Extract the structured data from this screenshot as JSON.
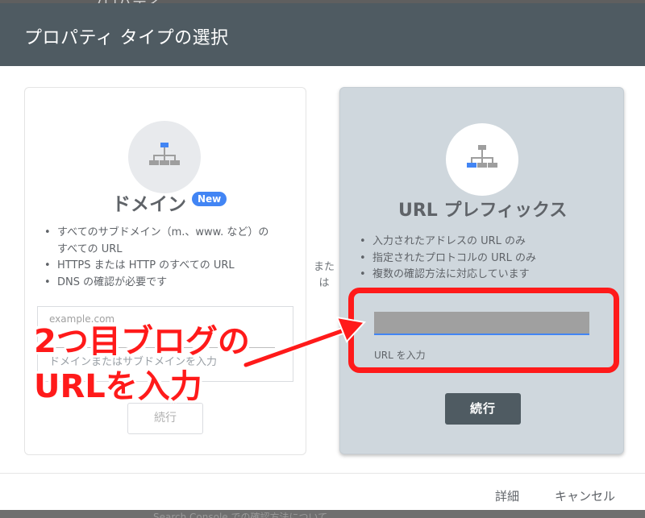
{
  "background": {
    "partial_title": "プロパティ",
    "partial_footer": "Search Console での確認方法について"
  },
  "dialog": {
    "title": "プロパティ タイプの選択"
  },
  "domain_card": {
    "title": "ドメイン",
    "badge": "New",
    "features": [
      "すべてのサブドメイン（m.、www. など）の\nすべての URL",
      "HTTPS または HTTP のすべての URL",
      "DNS の確認が必要です"
    ],
    "input_value": "example.com",
    "input_label": "ドメインまたはサブドメインを入力",
    "continue_label": "続行"
  },
  "separator": {
    "text": "または"
  },
  "url_prefix_card": {
    "title": "URL プレフィックス",
    "features": [
      "入力されたアドレスの URL のみ",
      "指定されたプロトコルの URL のみ",
      "複数の確認方法に対応しています"
    ],
    "input_value": "",
    "input_label": "URL を入力",
    "continue_label": "続行"
  },
  "footer": {
    "details_label": "詳細",
    "cancel_label": "キャンセル"
  },
  "annotation": {
    "line1": "2つ目ブログの",
    "line2": "URLを入力",
    "color": "#ff1a1a"
  },
  "colors": {
    "header_bg": "#4f5b62",
    "accent_blue": "#4285f4",
    "highlight_red": "#ff1a1a"
  }
}
